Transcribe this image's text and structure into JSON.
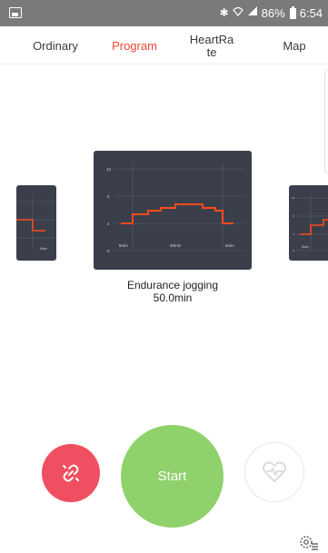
{
  "status_bar": {
    "bluetooth_icon": "bluetooth-icon",
    "wifi_icon": "wifi-icon",
    "signal_icon": "signal-icon",
    "battery_percent": "86%",
    "time": "6:54"
  },
  "tabs": [
    {
      "label": "Ordinary",
      "active": false
    },
    {
      "label": "Program",
      "active": true
    },
    {
      "label": "HeartRa te",
      "active": false
    },
    {
      "label": "Map",
      "active": false
    }
  ],
  "program_card": {
    "y_ticks": [
      "12",
      "8",
      "4",
      "0"
    ],
    "x_labels": [
      "5min",
      "40min",
      "5min"
    ],
    "name": "Endurance jogging",
    "duration": "50.0min"
  },
  "left_card": {
    "x_label": "5min"
  },
  "right_card": {
    "y_ticks": [
      "12",
      "8",
      "4",
      "0"
    ],
    "x_label": "5min"
  },
  "controls": {
    "start_label": "Start",
    "unlink_icon": "unlink-icon",
    "heartrate_icon": "heart-pulse-icon",
    "settings_icon": "settings-list-icon"
  },
  "colors": {
    "accent": "#f2452f",
    "start": "#8fd16a",
    "link_button": "#ef4f60",
    "card_bg": "#3a3f4b",
    "profile_line": "#ff4a1a"
  }
}
